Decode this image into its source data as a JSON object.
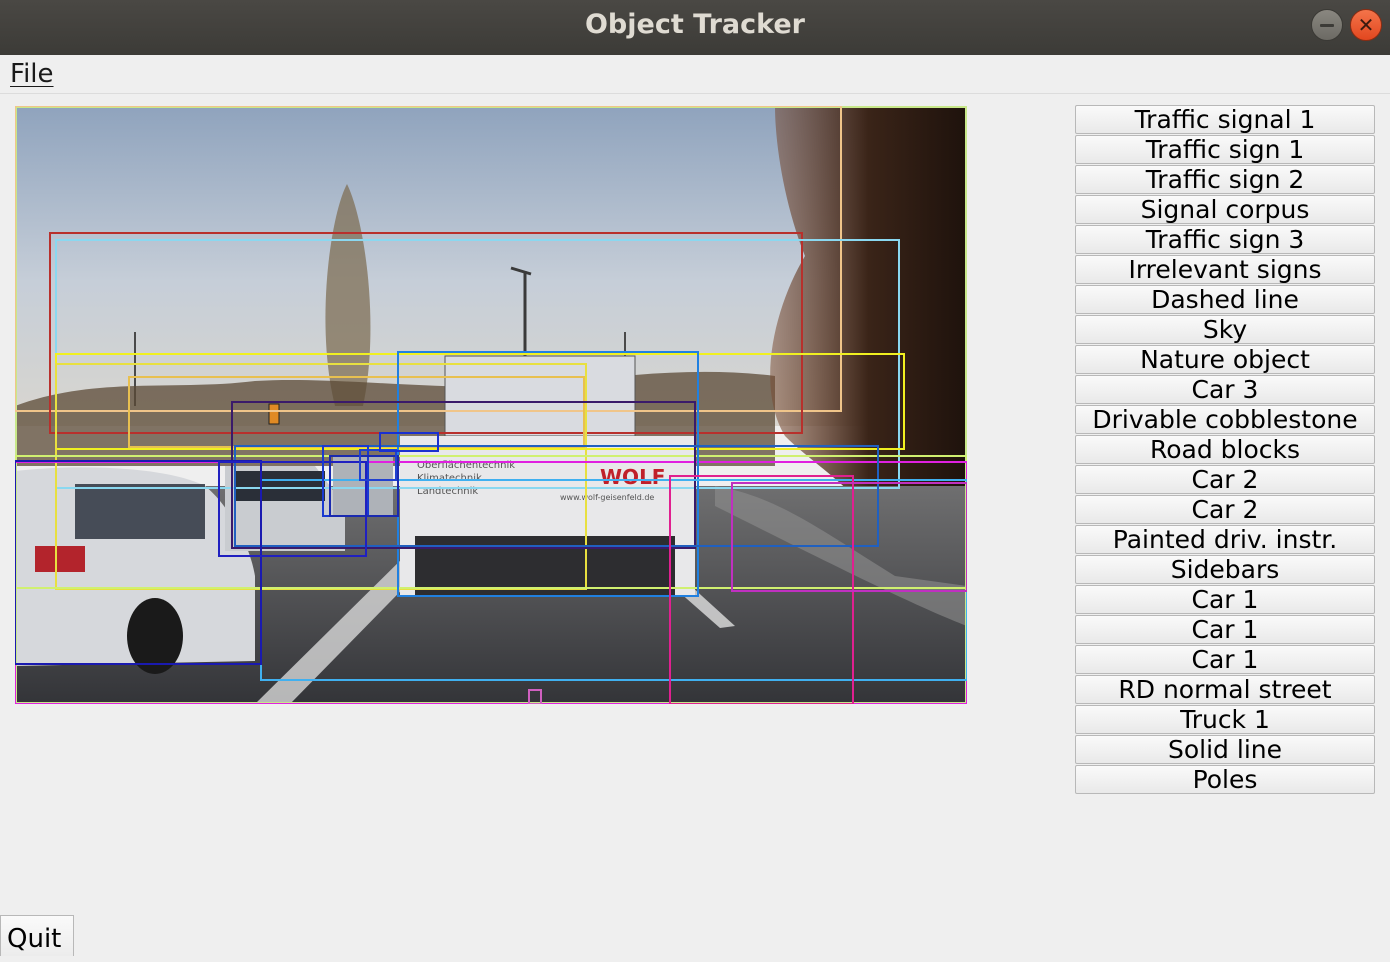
{
  "window": {
    "title": "Object Tracker"
  },
  "menu": {
    "file_label": "File"
  },
  "scene": {
    "truck_text_line1": "Oberflächentechnik",
    "truck_text_line2": "Klimatechnik",
    "truck_text_line3": "Landtechnik",
    "truck_logo": "WOLF",
    "truck_url": "www.wolf-geisenfeld.de"
  },
  "objects": [
    {
      "label": "Traffic signal 1"
    },
    {
      "label": "Traffic sign 1"
    },
    {
      "label": "Traffic sign 2"
    },
    {
      "label": "Signal corpus"
    },
    {
      "label": "Traffic sign 3"
    },
    {
      "label": "Irrelevant signs"
    },
    {
      "label": "Dashed line"
    },
    {
      "label": "Sky"
    },
    {
      "label": "Nature object"
    },
    {
      "label": "Car 3"
    },
    {
      "label": "Drivable cobblestone"
    },
    {
      "label": "Road blocks"
    },
    {
      "label": "Car 2"
    },
    {
      "label": "Car 2"
    },
    {
      "label": "Painted driv. instr."
    },
    {
      "label": "Sidebars"
    },
    {
      "label": "Car 1"
    },
    {
      "label": "Car 1"
    },
    {
      "label": "Car 1"
    },
    {
      "label": "RD normal street"
    },
    {
      "label": "Truck 1"
    },
    {
      "label": "Solid line"
    },
    {
      "label": "Poles"
    }
  ],
  "footer": {
    "quit_label": "Quit"
  }
}
